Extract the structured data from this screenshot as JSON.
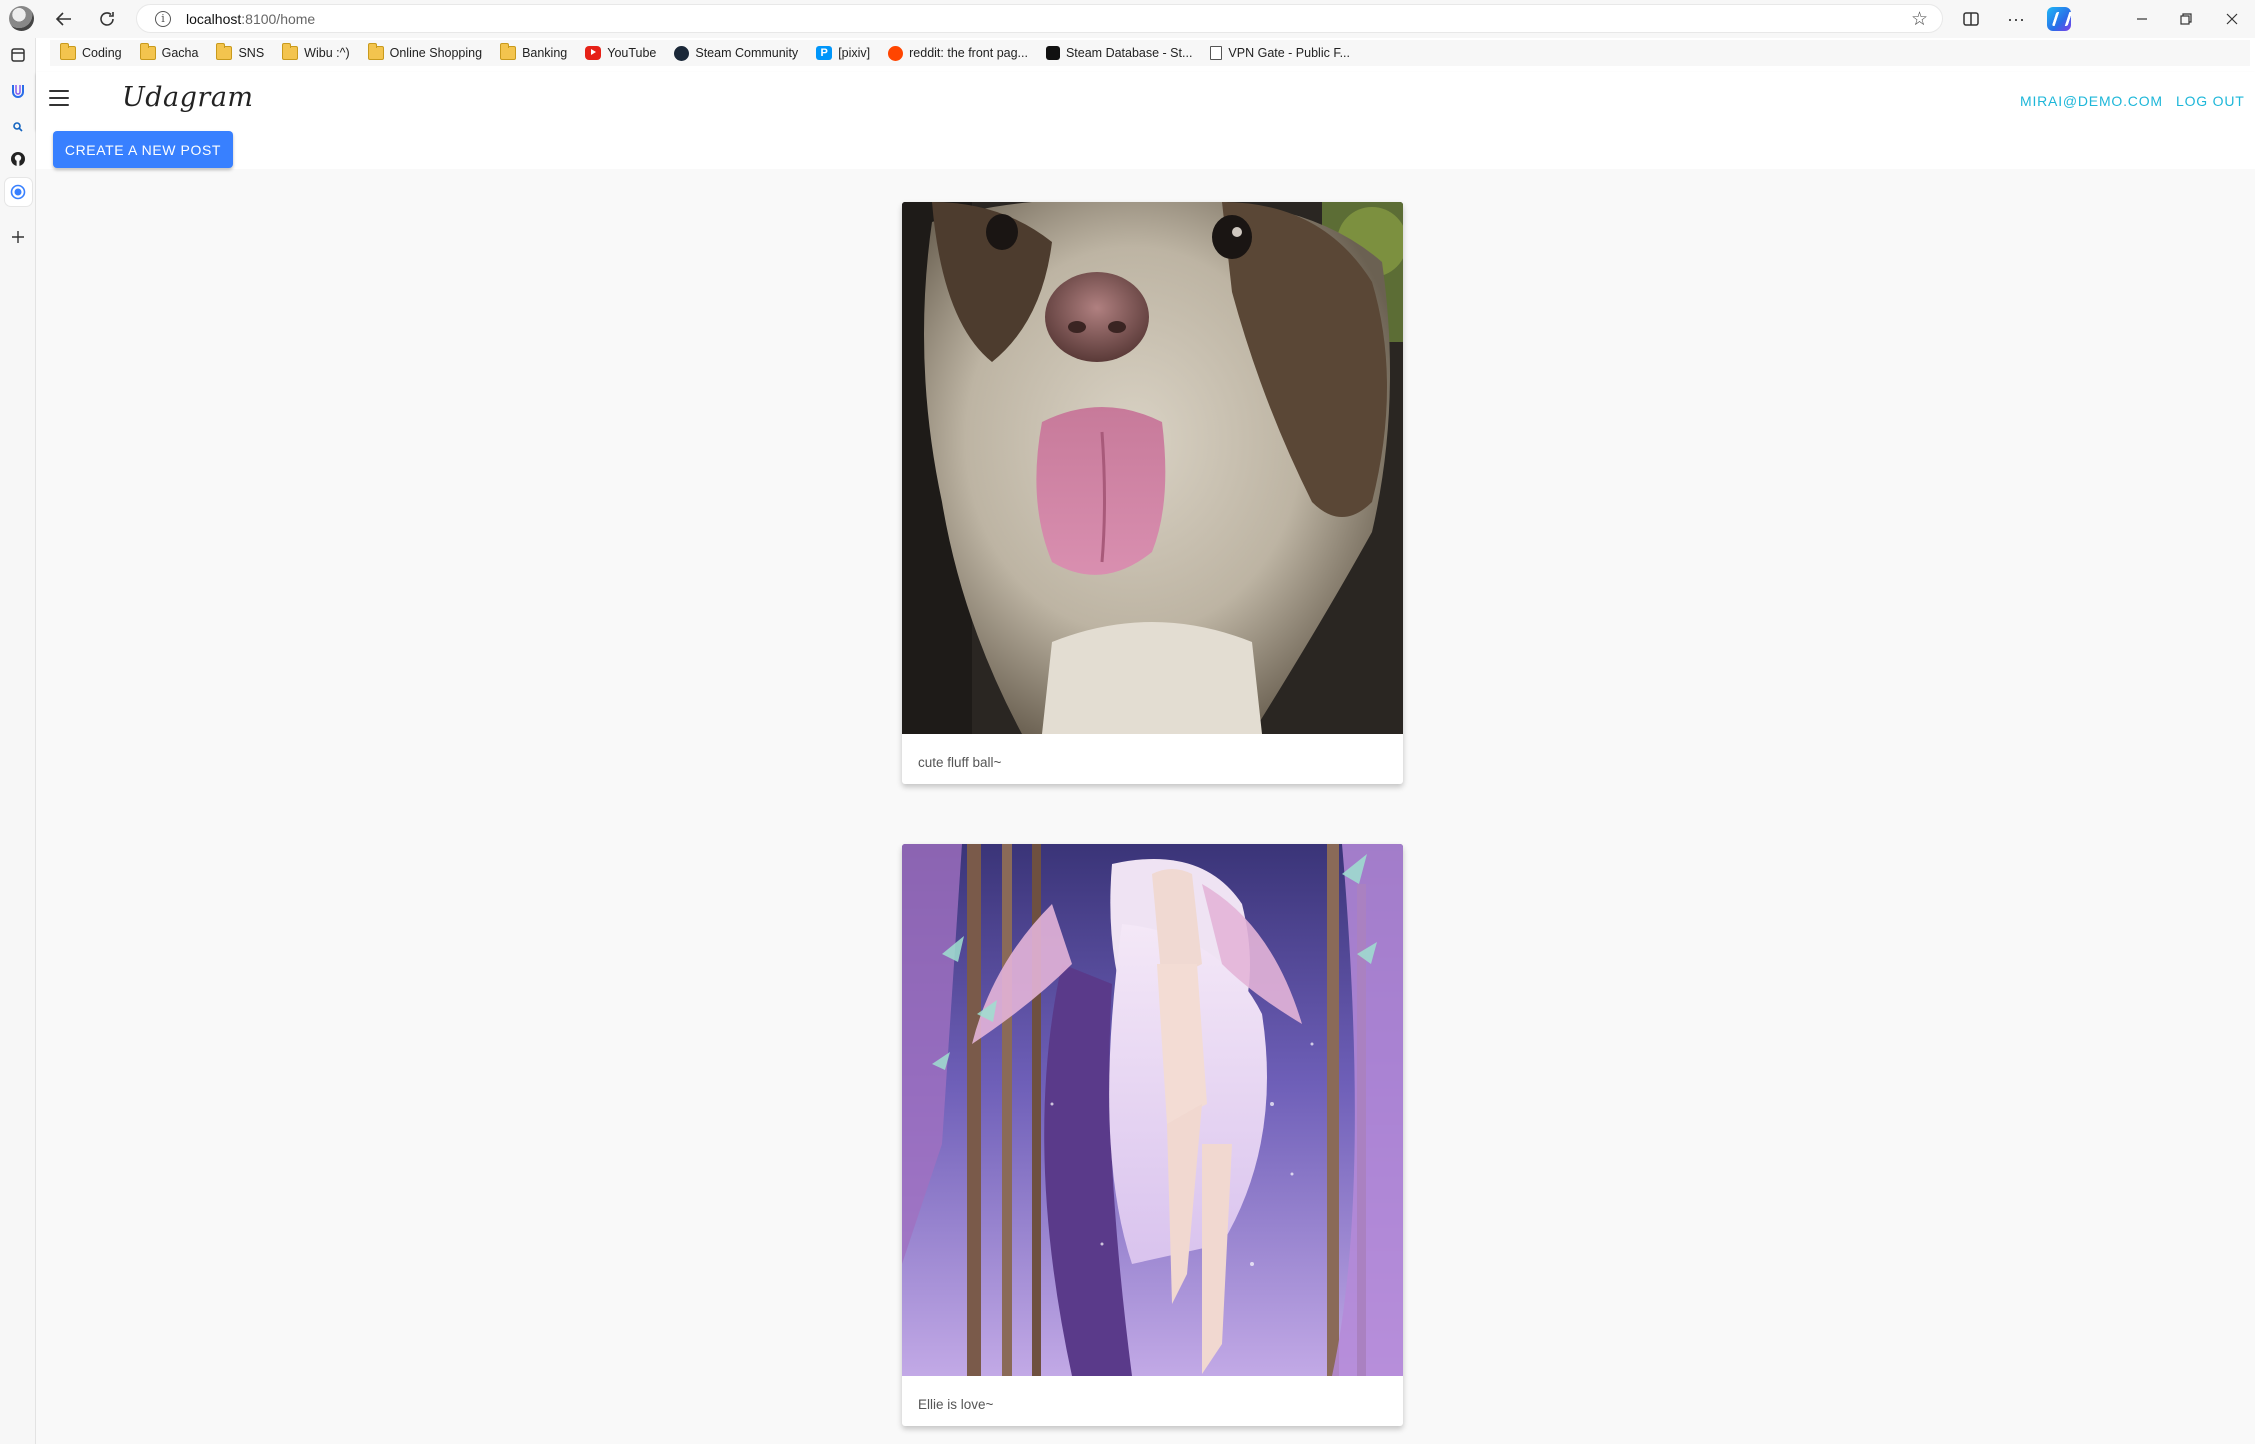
{
  "browser": {
    "url_host": "localhost",
    "url_path": ":8100/home",
    "bookmarks": [
      {
        "label": "Coding",
        "icon": "folder-icon"
      },
      {
        "label": "Gacha",
        "icon": "folder-icon"
      },
      {
        "label": "SNS",
        "icon": "folder-icon"
      },
      {
        "label": "Wibu :^)",
        "icon": "folder-icon"
      },
      {
        "label": "Online Shopping",
        "icon": "folder-icon"
      },
      {
        "label": "Banking",
        "icon": "folder-icon"
      },
      {
        "label": "YouTube",
        "icon": "youtube-icon"
      },
      {
        "label": "Steam Community",
        "icon": "steam-icon"
      },
      {
        "label": "[pixiv]",
        "icon": "pixiv-icon"
      },
      {
        "label": "reddit: the front pag...",
        "icon": "reddit-icon"
      },
      {
        "label": "Steam Database - St...",
        "icon": "steamdb-icon"
      },
      {
        "label": "VPN Gate - Public F...",
        "icon": "page-icon"
      }
    ]
  },
  "app": {
    "brand": "Udagram",
    "user_email": "MIRAI@DEMO.COM",
    "logout_label": "LOG OUT",
    "create_post_label": "CREATE A NEW POST"
  },
  "posts": [
    {
      "caption": "cute fluff ball~"
    },
    {
      "caption": "Ellie is love~"
    }
  ],
  "colors": {
    "accent": "#1eb7d9",
    "primary_button": "#3880ff"
  }
}
